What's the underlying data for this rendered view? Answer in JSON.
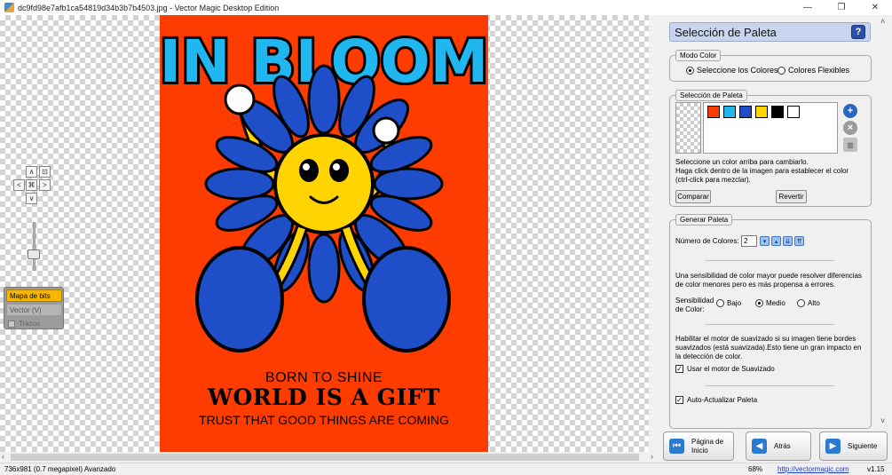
{
  "window": {
    "title": "dc9fd98e7afb1ca54819d34b3b7b4503.jpg - Vector Magic Desktop Edition",
    "controls": [
      "—",
      "❐",
      "✕"
    ]
  },
  "artwork": {
    "headline": "IN BLOOM",
    "line1": "BORN TO SHINE",
    "line2": "WORLD IS A GIFT",
    "line3": "TRUST THAT GOOD THINGS ARE COMING",
    "colors": {
      "background": "#ff3c00",
      "petals": "#1f4fc8",
      "sun": "#ffd400",
      "lettering": "#20b6f0"
    }
  },
  "view_panel": {
    "bitmap": "Mapa de bits (B)",
    "vector": "Vector (V)",
    "trazos": "Trazos"
  },
  "panel": {
    "title": "Selección de Paleta",
    "help": "?",
    "modo_color": {
      "legend": "Modo Color",
      "option1": "Seleccione los Colores",
      "option2": "Colores Flexibles",
      "selected": "Seleccione los Colores"
    },
    "seleccion": {
      "legend": "Selección de Paleta",
      "swatches": [
        "#ff3c00",
        "#20b6f0",
        "#1f4fc8",
        "#ffd400",
        "#000000",
        "#ffffff"
      ],
      "help_text1": "Seleccione un color arriba para cambiarlo.",
      "help_text2": "Haga click dentro de la imagen para establecer el color",
      "help_text3": "(ctrl-click para mezclar).",
      "compare": "Comparar",
      "revert": "Revertir"
    },
    "generar": {
      "legend": "Generar Paleta",
      "num_label": "Número de Colores:",
      "num_value": "2",
      "sens_text1": "Una sensibilidad de color mayor puede resolver diferencias",
      "sens_text2": "de color menores pero es más propensa a errores.",
      "sens_label1": "Sensibilidad",
      "sens_label2": "de Color:",
      "sens_low": "Bajo",
      "sens_mid": "Medio",
      "sens_high": "Alto",
      "sens_selected": "Medio",
      "smooth_text1": "Habilitar el motor de suavizado si su imagen tiene bordes",
      "smooth_text2": "suavizados (está suavizada).Esto tiene un gran impacto en",
      "smooth_text3": "la detección de color.",
      "smooth_check": "Usar el motor de Suavizado",
      "auto_check": "Auto-Actualizar Paleta"
    }
  },
  "bottom_nav": {
    "home1": "Página de",
    "home2": "Inicio",
    "back": "Atrás",
    "next": "Siguiente"
  },
  "status": {
    "dims": "736x981 (0.7 megapixel)  Avanzado",
    "zoom": "68%",
    "url": "http://vectormagic.com",
    "version": "v1.15"
  }
}
